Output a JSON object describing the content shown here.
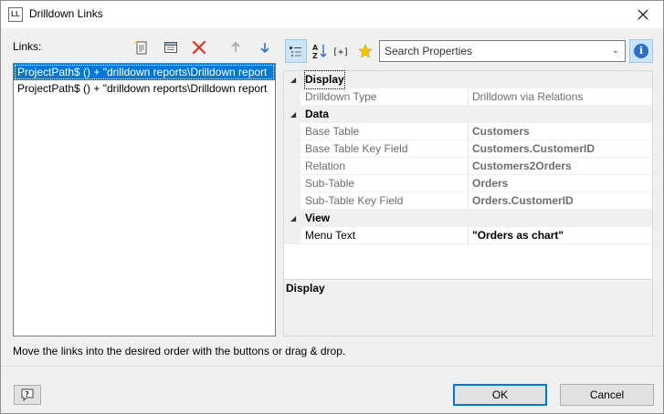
{
  "window": {
    "title": "Drilldown Links",
    "icon_text": "LL"
  },
  "links": {
    "label": "Links:",
    "items": [
      {
        "text": "ProjectPath$ () + \"drilldown reports\\Drilldown report",
        "selected": true
      },
      {
        "text": "ProjectPath$ () + \"drilldown reports\\Drilldown report",
        "selected": false
      }
    ]
  },
  "toolbar": {
    "icons": [
      "new-link-icon",
      "edit-link-icon",
      "delete-icon",
      "move-up-icon",
      "move-down-icon"
    ],
    "delete_color": "#e0321e",
    "arrow_color": "#2e6fc9"
  },
  "properties": {
    "toolbar_icons": [
      "categorized-view-icon",
      "sort-alphabetical-icon",
      "expand-all-icon",
      "favorites-star-icon",
      "info-icon"
    ],
    "search_placeholder": "Search Properties",
    "categories": [
      {
        "name": "Display",
        "rows": [
          {
            "name": "Drilldown Type",
            "value": "Drilldown via Relations"
          }
        ]
      },
      {
        "name": "Data",
        "rows": [
          {
            "name": "Base Table",
            "value": "Customers"
          },
          {
            "name": "Base Table Key Field",
            "value": "Customers.CustomerID"
          },
          {
            "name": "Relation",
            "value": "Customers2Orders"
          },
          {
            "name": "Sub-Table",
            "value": "Orders"
          },
          {
            "name": "Sub-Table Key Field",
            "value": "Orders.CustomerID"
          }
        ]
      },
      {
        "name": "View",
        "rows": [
          {
            "name": "Menu Text",
            "value": "\"Orders as chart\""
          }
        ]
      }
    ],
    "description_title": "Display"
  },
  "hint": "Move the links into the desired order with the buttons or drag & drop.",
  "buttons": {
    "help": "help-icon",
    "ok": "OK",
    "cancel": "Cancel"
  },
  "colors": {
    "selection": "#0078d7",
    "accent": "#0078d7"
  }
}
